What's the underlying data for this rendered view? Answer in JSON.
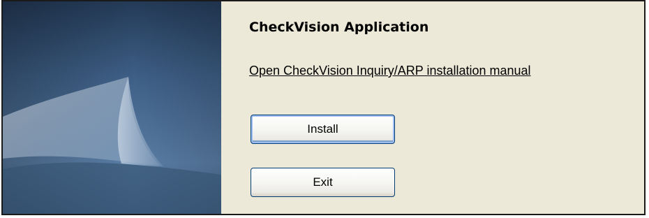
{
  "app": {
    "title": "CheckVision Application"
  },
  "links": {
    "manual": "Open CheckVision Inquiry/ARP installation manual"
  },
  "buttons": {
    "install": "Install",
    "exit": "Exit"
  },
  "colors": {
    "background": "#ece9d8",
    "panel_dark": "#1f3550",
    "panel_light": "#5b7ea3",
    "button_border": "#003c74"
  }
}
